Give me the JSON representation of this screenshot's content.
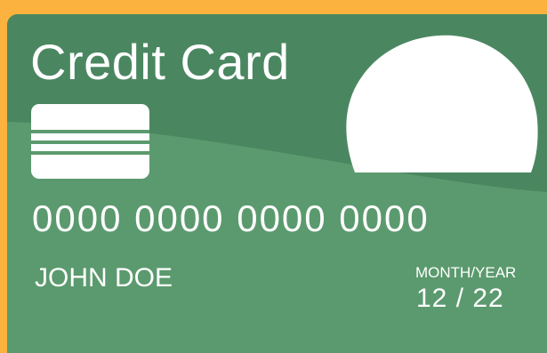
{
  "card": {
    "title": "Credit Card",
    "number": "0000 0000 0000 0000",
    "holder_name": "JOHN DOE",
    "expiry_label": "MONTH/YEAR",
    "expiry_value": "12 / 22"
  },
  "colors": {
    "background": "#fbb23e",
    "card_dark": "#4a8760",
    "card_light": "#5b9a6e",
    "text": "#ffffff"
  },
  "icons": {
    "chip": "chip-icon",
    "hologram": "hologram-icon"
  }
}
